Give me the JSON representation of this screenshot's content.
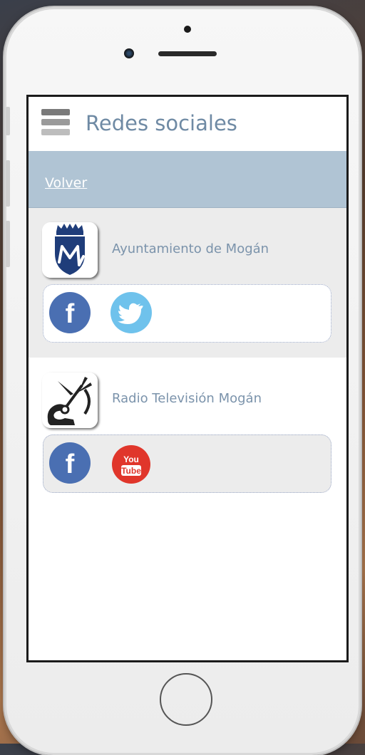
{
  "header": {
    "title": "Redes sociales"
  },
  "nav": {
    "back_label": "Volver"
  },
  "entries": [
    {
      "name": "Ayuntamiento de Mogán",
      "links": [
        "facebook",
        "twitter"
      ]
    },
    {
      "name": "Radio Televisión Mogán",
      "links": [
        "facebook",
        "youtube"
      ],
      "youtube_badge": [
        "You",
        "Tube"
      ]
    }
  ],
  "colors": {
    "facebook": "#4a6fb2",
    "twitter": "#6fc2ec",
    "youtube": "#e0362b",
    "title": "#6f8aa4",
    "backbar": "#b0c4d4"
  },
  "icons": {
    "menu": "hamburger-icon",
    "facebook": "facebook-icon",
    "twitter": "twitter-icon",
    "youtube": "youtube-icon"
  }
}
